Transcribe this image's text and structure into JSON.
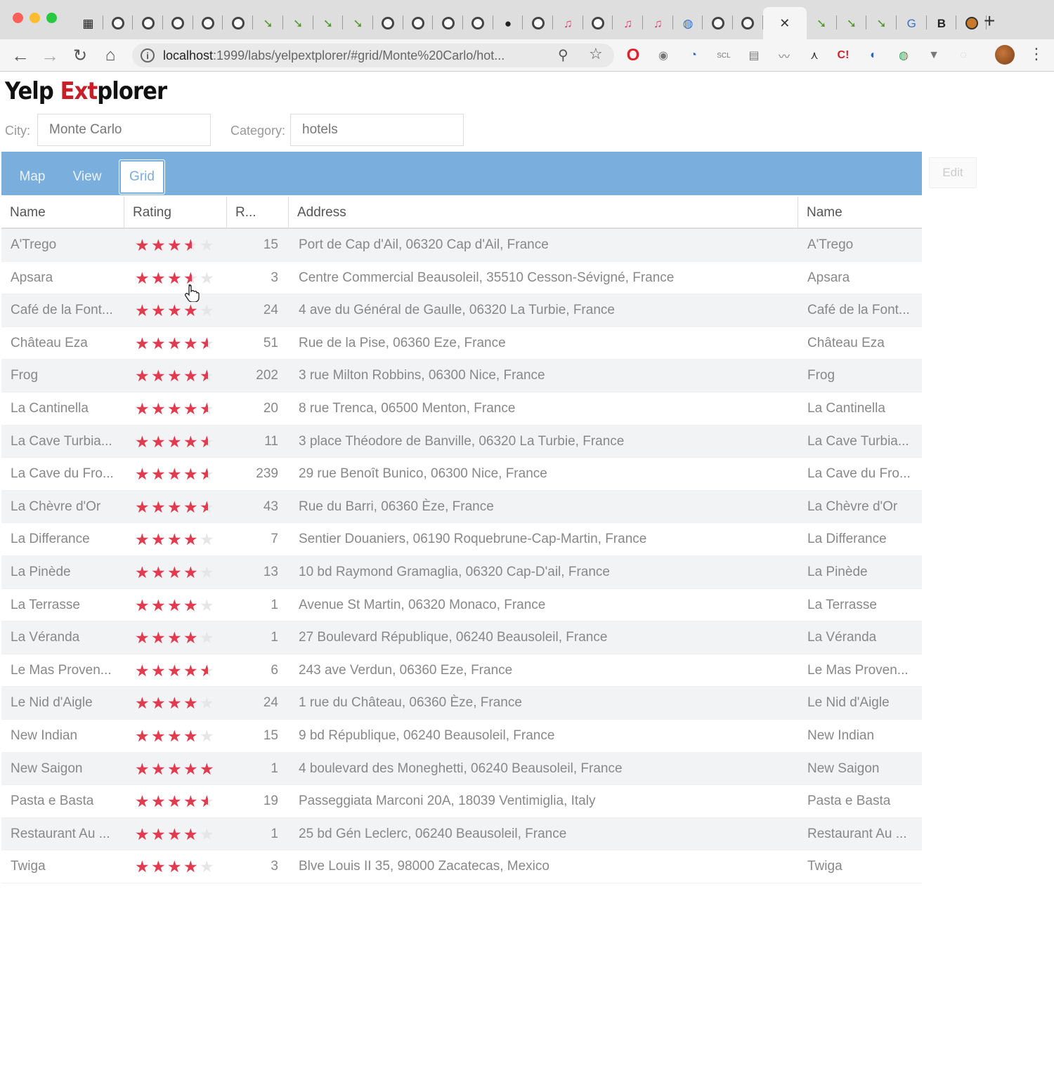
{
  "browser": {
    "url_host": "localhost",
    "url_rest": ":1999/labs/yelpextplorer/#grid/Monte%20Carlo/hot...",
    "active_tab_close": "✕",
    "new_tab": "+",
    "tab_favicons": [
      "calendar",
      "globe",
      "globe",
      "globe",
      "globe",
      "globe",
      "green-arrow",
      "green-arrow",
      "green-arrow",
      "green-arrow",
      "globe",
      "globe",
      "globe",
      "globe",
      "apple",
      "globe",
      "note",
      "globe",
      "note",
      "note",
      "world",
      "globe",
      "globe",
      "active",
      "green-arrow",
      "green-arrow",
      "green-arrow",
      "google",
      "bold-b",
      "orange-circle"
    ]
  },
  "app": {
    "logo": {
      "part1": "Yelp ",
      "part2": "Ext",
      "part3": "plorer"
    },
    "city_label": "City:",
    "city_value": "Monte Carlo",
    "category_label": "Category:",
    "category_value": "hotels",
    "toolbar": {
      "map": "Map",
      "view": "View",
      "grid": "Grid",
      "edit": "Edit"
    },
    "accent_color": "#7aaedd",
    "star_color": "#e23a4f",
    "columns": [
      "Name",
      "Rating",
      "R...",
      "Address",
      "Name"
    ]
  },
  "rows": [
    {
      "name": "A'Trego",
      "rating": 3.5,
      "reviews": "15",
      "address": "Port de Cap d'Ail, 06320 Cap d'Ail, France"
    },
    {
      "name": "Apsara",
      "rating": 3.5,
      "reviews": "3",
      "address": "Centre Commercial Beausoleil, 35510 Cesson-Sévigné, France"
    },
    {
      "name": "Café de la Font...",
      "rating": 4,
      "reviews": "24",
      "address": "4 ave du Général de Gaulle, 06320 La Turbie, France"
    },
    {
      "name": "Château Eza",
      "rating": 4.5,
      "reviews": "51",
      "address": "Rue de la Pise, 06360 Eze, France"
    },
    {
      "name": "Frog",
      "rating": 4.5,
      "reviews": "202",
      "address": "3 rue Milton Robbins, 06300 Nice, France"
    },
    {
      "name": "La Cantinella",
      "rating": 4.5,
      "reviews": "20",
      "address": "8 rue Trenca, 06500 Menton, France"
    },
    {
      "name": "La Cave Turbia...",
      "rating": 4.5,
      "reviews": "11",
      "address": "3 place Théodore de Banville, 06320 La Turbie, France"
    },
    {
      "name": "La Cave du Fro...",
      "rating": 4.5,
      "reviews": "239",
      "address": "29 rue Benoît Bunico, 06300 Nice, France"
    },
    {
      "name": "La Chèvre d'Or",
      "rating": 4.5,
      "reviews": "43",
      "address": "Rue du Barri, 06360 Èze, France"
    },
    {
      "name": "La Differance",
      "rating": 4,
      "reviews": "7",
      "address": "Sentier Douaniers, 06190 Roquebrune-Cap-Martin, France"
    },
    {
      "name": "La Pinède",
      "rating": 4,
      "reviews": "13",
      "address": "10 bd Raymond Gramaglia, 06320 Cap-D'ail, France"
    },
    {
      "name": "La Terrasse",
      "rating": 4,
      "reviews": "1",
      "address": "Avenue St Martin, 06320 Monaco, France"
    },
    {
      "name": "La Véranda",
      "rating": 4,
      "reviews": "1",
      "address": "27 Boulevard République, 06240 Beausoleil, France"
    },
    {
      "name": "Le Mas Proven...",
      "rating": 4.5,
      "reviews": "6",
      "address": "243 ave Verdun, 06360 Eze, France"
    },
    {
      "name": "Le Nid d'Aigle",
      "rating": 4,
      "reviews": "24",
      "address": "1 rue du Château, 06360 Èze, France"
    },
    {
      "name": "New Indian",
      "rating": 4,
      "reviews": "15",
      "address": "9 bd République, 06240 Beausoleil, France"
    },
    {
      "name": "New Saigon",
      "rating": 5,
      "reviews": "1",
      "address": "4 boulevard des Moneghetti, 06240 Beausoleil, France"
    },
    {
      "name": "Pasta e Basta",
      "rating": 4.5,
      "reviews": "19",
      "address": "Passeggiata Marconi 20A, 18039 Ventimiglia, Italy"
    },
    {
      "name": "Restaurant Au ...",
      "rating": 4,
      "reviews": "1",
      "address": "25 bd Gén Leclerc, 06240 Beausoleil, France"
    },
    {
      "name": "Twiga",
      "rating": 4,
      "reviews": "3",
      "address": "Blve Louis II 35, 98000 Zacatecas, Mexico"
    }
  ]
}
